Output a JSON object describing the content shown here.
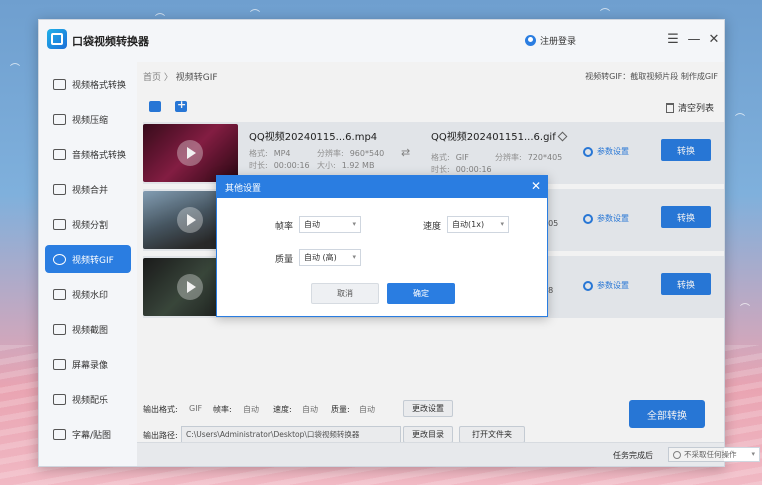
{
  "app": {
    "title": "口袋视频转换器",
    "login": "注册登录"
  },
  "window_controls": [
    "☰",
    "—",
    "✕"
  ],
  "sidebar": {
    "items": [
      {
        "label": "视频格式转换",
        "active": false
      },
      {
        "label": "视频压缩",
        "active": false
      },
      {
        "label": "音频格式转换",
        "active": false
      },
      {
        "label": "视频合并",
        "active": false
      },
      {
        "label": "视频分割",
        "active": false
      },
      {
        "label": "视频转GIF",
        "active": true
      },
      {
        "label": "视频水印",
        "active": false
      },
      {
        "label": "视频截图",
        "active": false
      },
      {
        "label": "屏幕录像",
        "active": false
      },
      {
        "label": "视频配乐",
        "active": false
      },
      {
        "label": "字幕/贴图",
        "active": false
      }
    ]
  },
  "breadcrumb": {
    "home": "首页",
    "sep": "〉",
    "current": "视频转GIF"
  },
  "hint": "视频转GIF：截取视频片段 制作成GIF",
  "toolbar": {
    "clear_list": "清空列表"
  },
  "files": [
    {
      "name": "QQ视频20240115...6.mp4",
      "format_label": "格式:",
      "format": "MP4",
      "resolution_label": "分辨率:",
      "resolution": "960*540",
      "duration_label": "时长:",
      "duration": "00:00:16",
      "size_label": "大小:",
      "size": "1.92 MB",
      "out_name": "QQ视频20240115​1...6.gif",
      "out_format": "GIF",
      "out_resolution": "720*405",
      "out_duration": "00:00:16",
      "param_label": "参数设置",
      "convert_label": "转换"
    },
    {
      "out_resolution": "405",
      "param_label": "参数设置",
      "convert_label": "转换"
    },
    {
      "out_resolution": "98",
      "param_label": "参数设置",
      "convert_label": "转换"
    }
  ],
  "footer": {
    "output_format_label": "输出格式:",
    "output_format": "GIF",
    "framerate_label": "帧率:",
    "framerate": "自动",
    "speed_label": "速度:",
    "speed": "自动",
    "quality_label": "质量:",
    "quality": "自动",
    "change_settings": "更改设置",
    "output_path_label": "输出路径:",
    "output_path": "C:\\Users\\Administrator\\Desktop\\口袋视频转换器",
    "change_dir": "更改目录",
    "open_folder": "打开文件夹",
    "convert_all": "全部转换"
  },
  "status": {
    "label": "任务完成后",
    "option": "不采取任何操作"
  },
  "dialog": {
    "title": "其他设置",
    "framerate_label": "帧率",
    "framerate": "自动",
    "speed_label": "速度",
    "speed": "自动(1x)",
    "quality_label": "质量",
    "quality": "自动 (高)",
    "cancel": "取消",
    "ok": "确定"
  },
  "colors": {
    "accent": "#2a7de1",
    "background_pink": "#f1b9c4",
    "background_blue": "#7fb0dc"
  }
}
